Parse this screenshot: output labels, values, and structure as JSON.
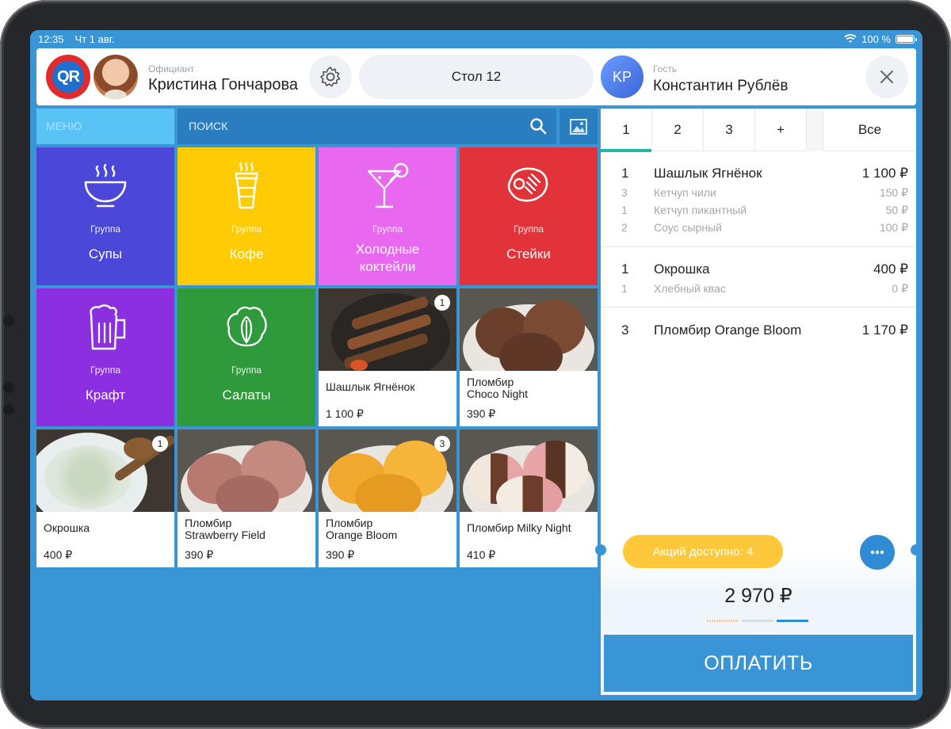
{
  "status_bar": {
    "time": "12:35",
    "date": "Чт 1 авг.",
    "battery": "100 %"
  },
  "header": {
    "waiter_label": "Официант",
    "waiter_name": "Кристина Гончарова",
    "table": "Стол 12",
    "guest_initials": "KP",
    "guest_label": "Гость",
    "guest_name": "Константин Рублёв"
  },
  "menu": {
    "tab_label": "МЕНЮ",
    "search_placeholder": "ПОИСК",
    "groups": [
      {
        "sub": "Группа",
        "name": "Супы",
        "color": "#4b47d9",
        "icon": "soup-bowl-icon"
      },
      {
        "sub": "Группа",
        "name": "Кофе",
        "color": "#ffcb05",
        "icon": "coffee-cup-icon"
      },
      {
        "sub": "Группа",
        "name": "Холодные коктейли",
        "color": "#e868f0",
        "icon": "cocktail-icon"
      },
      {
        "sub": "Группа",
        "name": "Стейки",
        "color": "#e3333a",
        "icon": "steak-icon"
      },
      {
        "sub": "Группа",
        "name": "Крафт",
        "color": "#8b2fe0",
        "icon": "beer-mug-icon"
      },
      {
        "sub": "Группа",
        "name": "Салаты",
        "color": "#2e9a3c",
        "icon": "lettuce-icon"
      }
    ],
    "products": [
      {
        "name": "Шашлык Ягнёнок",
        "price": "1 100 ₽",
        "badge": "1"
      },
      {
        "name": "Пломбир Choco Night",
        "price": "390 ₽",
        "badge": ""
      },
      {
        "name": "Окрошка",
        "price": "400 ₽",
        "badge": "1"
      },
      {
        "name": "Пломбир Strawberry Field",
        "price": "390 ₽",
        "badge": ""
      },
      {
        "name": "Пломбир Orange Bloom",
        "price": "390 ₽",
        "badge": "3"
      },
      {
        "name": "Пломбир Milky Night",
        "price": "410 ₽",
        "badge": ""
      }
    ]
  },
  "order": {
    "tabs": [
      "1",
      "2",
      "3",
      "+",
      "Все"
    ],
    "active_tab": "1",
    "accent": "#25b6a0",
    "items": [
      {
        "qty": "1",
        "name": "Шашлык Ягнёнок",
        "price": "1 100 ₽",
        "mods": [
          {
            "qty": "3",
            "name": "Кетчуп чили",
            "price": "150 ₽"
          },
          {
            "qty": "1",
            "name": "Кетчуп пикантный",
            "price": "50 ₽"
          },
          {
            "qty": "2",
            "name": "Соус сырный",
            "price": "100 ₽"
          }
        ]
      },
      {
        "qty": "1",
        "name": "Окрошка",
        "price": "400 ₽",
        "mods": [
          {
            "qty": "1",
            "name": "Хлебный квас",
            "price": "0 ₽"
          }
        ]
      },
      {
        "qty": "3",
        "name": "Пломбир Orange Bloom",
        "price": "1 170 ₽",
        "mods": []
      }
    ],
    "promo": "Акций доступно: 4",
    "total": "2 970 ₽",
    "pay": "ОПЛАТИТЬ"
  }
}
